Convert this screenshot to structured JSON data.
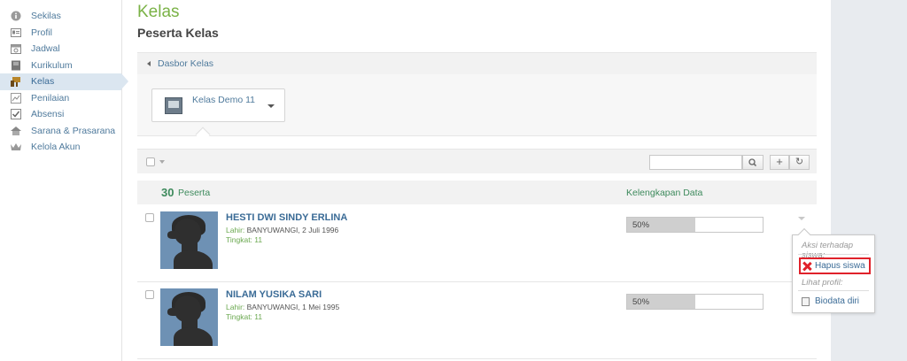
{
  "sidebar": {
    "items": [
      {
        "label": "Sekilas",
        "icon": "info-icon"
      },
      {
        "label": "Profil",
        "icon": "profile-card-icon"
      },
      {
        "label": "Jadwal",
        "icon": "calendar-icon"
      },
      {
        "label": "Kurikulum",
        "icon": "book-icon"
      },
      {
        "label": "Kelas",
        "icon": "classroom-icon",
        "active": true
      },
      {
        "label": "Penilaian",
        "icon": "grading-icon"
      },
      {
        "label": "Absensi",
        "icon": "checkbox-icon"
      },
      {
        "label": "Sarana & Prasarana",
        "icon": "house-icon"
      },
      {
        "label": "Kelola Akun",
        "icon": "crown-icon"
      }
    ]
  },
  "header": {
    "title": "Kelas",
    "subtitle": "Peserta Kelas"
  },
  "breadcrumb": {
    "label": "Dasbor Kelas"
  },
  "class_select": {
    "value": "Kelas Demo 11"
  },
  "toolbar": {
    "search_placeholder": "",
    "add_label": "+",
    "refresh_label": "↻"
  },
  "list": {
    "count": "30",
    "count_label": "Peserta",
    "completeness_label": "Kelengkapan Data",
    "students": [
      {
        "name": "HESTI DWI SINDY ERLINA",
        "birth_label": "Lahir:",
        "birth_value": "BANYUWANGI, 2 Juli 1996",
        "grade_label": "Tingkat:",
        "grade_value": "11",
        "completeness": "50%",
        "completeness_fraction": 0.5
      },
      {
        "name": "NILAM YUSIKA SARI",
        "birth_label": "Lahir:",
        "birth_value": "BANYUWANGI, 1 Mei 1995",
        "grade_label": "Tingkat:",
        "grade_value": "11",
        "completeness": "50%",
        "completeness_fraction": 0.5
      }
    ]
  },
  "popup": {
    "action_heading": "Aksi terhadap siswa:",
    "delete_label": "Hapus siswa",
    "profile_heading": "Lihat profil:",
    "biodata_label": "Biodata diri"
  },
  "colors": {
    "accent_green": "#7ab246",
    "link_blue": "#3a6b96",
    "danger_red": "#e0212a"
  }
}
